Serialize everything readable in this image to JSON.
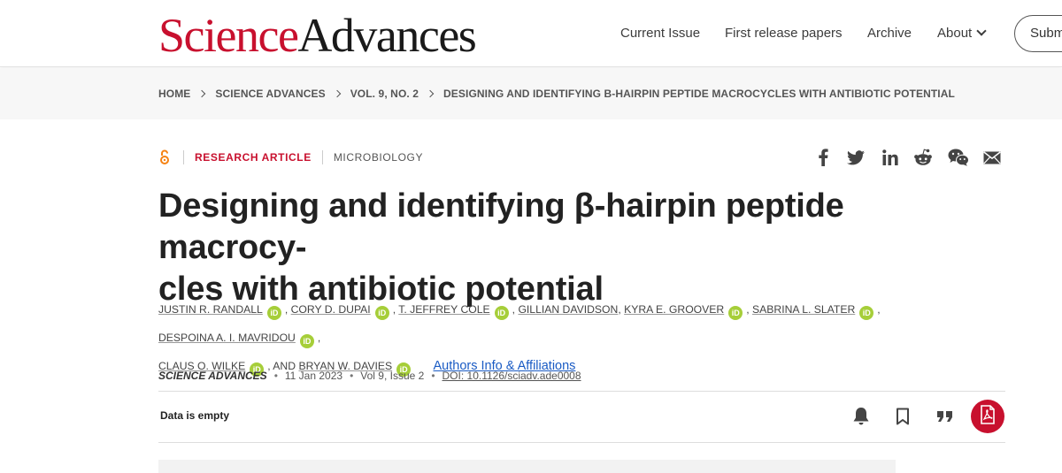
{
  "logo": {
    "part1": "Science",
    "part2": "Advances"
  },
  "nav": {
    "current_issue": "Current Issue",
    "first_release": "First release papers",
    "archive": "Archive",
    "about": "About",
    "submit": "Subm"
  },
  "breadcrumb": [
    "HOME",
    "SCIENCE ADVANCES",
    "VOL. 9, NO. 2",
    "DESIGNING AND IDENTIFYING Β-HAIRPIN PEPTIDE MACROCYCLES WITH ANTIBIOTIC POTENTIAL"
  ],
  "article": {
    "type": "RESEARCH ARTICLE",
    "subject": "MICROBIOLOGY",
    "title_line1": "Designing and identifying β-hairpin peptide macrocy-",
    "title_line2": "cles with antibiotic potential",
    "authors": [
      "JUSTIN R. RANDALL",
      "CORY D. DUPAI",
      "T. JEFFREY COLE",
      "GILLIAN DAVIDSON",
      "KYRA E. GROOVER",
      "SABRINA L. SLATER",
      "DESPOINA A. I. MAVRIDOU",
      "CLAUS O. WILKE",
      "BRYAN W. DAVIES"
    ],
    "and_text": ", AND",
    "orcid_label": "iD",
    "affiliations_link": "Authors Info & Affiliations",
    "journal": "SCIENCE ADVANCES",
    "date": "11 Jan 2023",
    "volume": "Vol 9, Issue 2",
    "doi": "DOI: 10.1126/sciadv.ade0008",
    "data_status": "Data is empty"
  },
  "colors": {
    "brand_red": "#c8102e",
    "orcid_green": "#a6ce39",
    "link_blue": "#1a5bc4"
  },
  "icons": [
    "open-access-icon",
    "facebook-icon",
    "twitter-icon",
    "linkedin-icon",
    "reddit-icon",
    "wechat-icon",
    "email-icon",
    "bell-icon",
    "bookmark-icon",
    "quote-icon",
    "pdf-icon"
  ]
}
